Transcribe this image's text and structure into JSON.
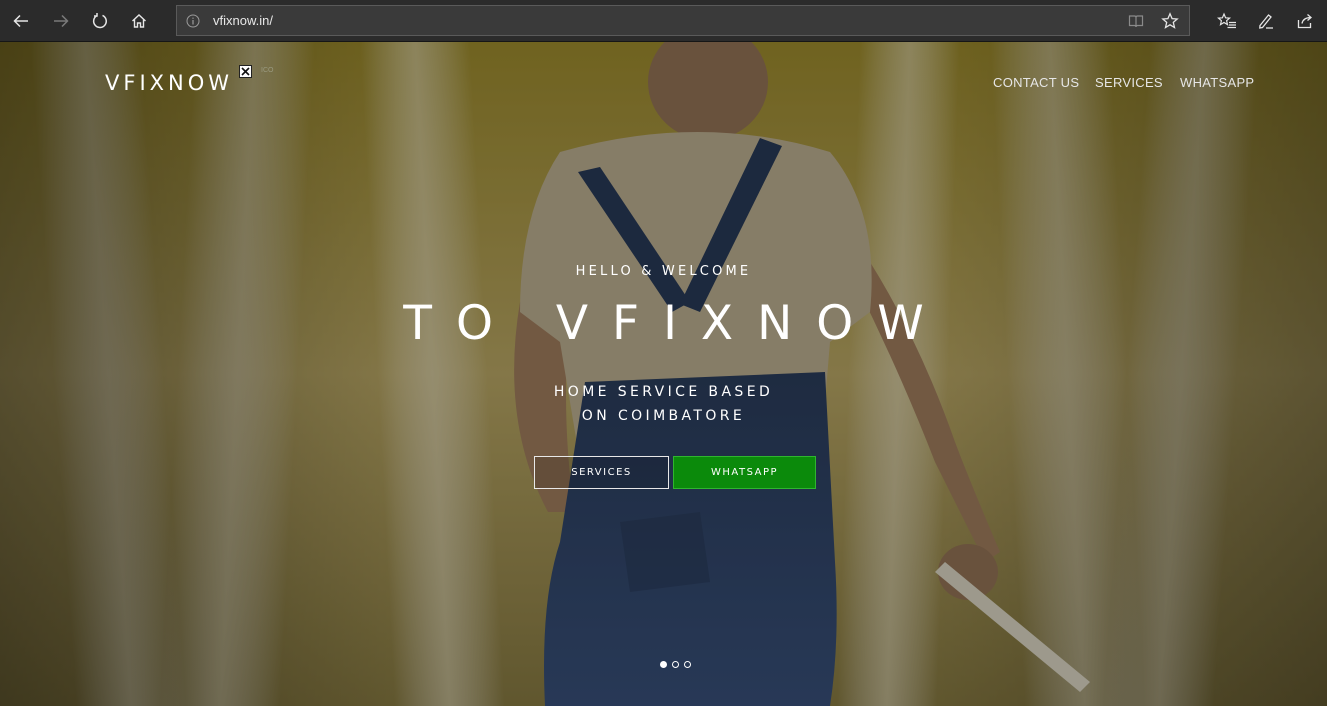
{
  "browser": {
    "url": "vfixnow.in/",
    "icons": [
      "back-icon",
      "forward-icon",
      "refresh-icon",
      "home-icon",
      "info-icon",
      "reading-view-icon",
      "favorite-star-icon",
      "favorites-list-icon",
      "pen-icon",
      "share-icon"
    ]
  },
  "site": {
    "logo": "VFIXNOW",
    "broken_image_alt": "ICO",
    "nav": {
      "contact": "CONTACT US",
      "services": "SERVICES",
      "whatsapp": "WHATSAPP"
    }
  },
  "hero": {
    "greeting": "HELLO & WELCOME",
    "title": "TO VFIXNOW",
    "subtitle_line1": "HOME SERVICE BASED",
    "subtitle_line2": "ON COIMBATORE",
    "buttons": {
      "services": "SERVICES",
      "whatsapp": "WHATSAPP"
    },
    "slider": {
      "slides": 3,
      "active": 1
    }
  },
  "colors": {
    "chrome": "#2b2b2b",
    "whatsapp_button": "#0b8a0b",
    "hero_yellow": "#b7a24a"
  }
}
